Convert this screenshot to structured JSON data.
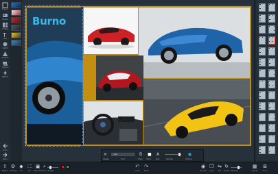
{
  "left_toolbar": {
    "items": [
      {
        "label": "Expand",
        "icon": "expand-icon"
      },
      {
        "label": "Photos",
        "icon": "photos-icon"
      },
      {
        "label": "Collage",
        "icon": "collage-icon"
      },
      {
        "label": "Text",
        "icon": "text-icon"
      },
      {
        "label": "Clipart",
        "icon": "clipart-icon"
      },
      {
        "label": "Shapes",
        "icon": "shapes-icon"
      },
      {
        "label": "Layers",
        "icon": "layers-icon"
      },
      {
        "label": "Effects",
        "icon": "effects-icon"
      }
    ],
    "bottom_items": [
      {
        "label": "Undo",
        "icon": "undo-icon"
      },
      {
        "label": "Redo",
        "icon": "redo-icon"
      }
    ]
  },
  "watermark_text": "Burno",
  "properties_bar": {
    "delete_label": "Delete",
    "font_value": "Arial",
    "font_label": "Font",
    "style_label": "Style",
    "color_label": "Color",
    "size_label": "Size",
    "opacity_label": "Opacity",
    "outline_label": "Outline"
  },
  "bottom_toolbar": {
    "left": [
      {
        "label": "Export",
        "icon": "export-icon"
      },
      {
        "label": "Settings",
        "icon": "settings-icon"
      },
      {
        "label": "Fill",
        "icon": "fill-icon"
      },
      {
        "label": "Fit",
        "icon": "fit-icon"
      },
      {
        "label": "Fullscreen",
        "icon": "fullscreen-icon"
      },
      {
        "label": "Zoom",
        "icon": "zoom-icon"
      }
    ],
    "margin_label": "Margin",
    "center": [
      {
        "label": "Undo",
        "icon": "undo-icon"
      },
      {
        "label": "Redo",
        "icon": "redo-icon"
      }
    ],
    "right": [
      {
        "label": "Preview",
        "icon": "eye-icon"
      },
      {
        "label": "Copy",
        "icon": "copy-icon"
      },
      {
        "label": "Flip",
        "icon": "flip-icon"
      },
      {
        "label": "Rotate",
        "icon": "rotate-icon"
      }
    ],
    "spacing_label": "Spacing",
    "end": [
      {
        "label": "Layout",
        "icon": "layout-icon"
      },
      {
        "label": "Grid",
        "icon": "grid-icon"
      }
    ],
    "colors": {
      "border": "#e01f25",
      "background": "#26a849"
    }
  },
  "colors": {
    "collage_border": "#c48f10",
    "accent": "#2a9fd6"
  }
}
